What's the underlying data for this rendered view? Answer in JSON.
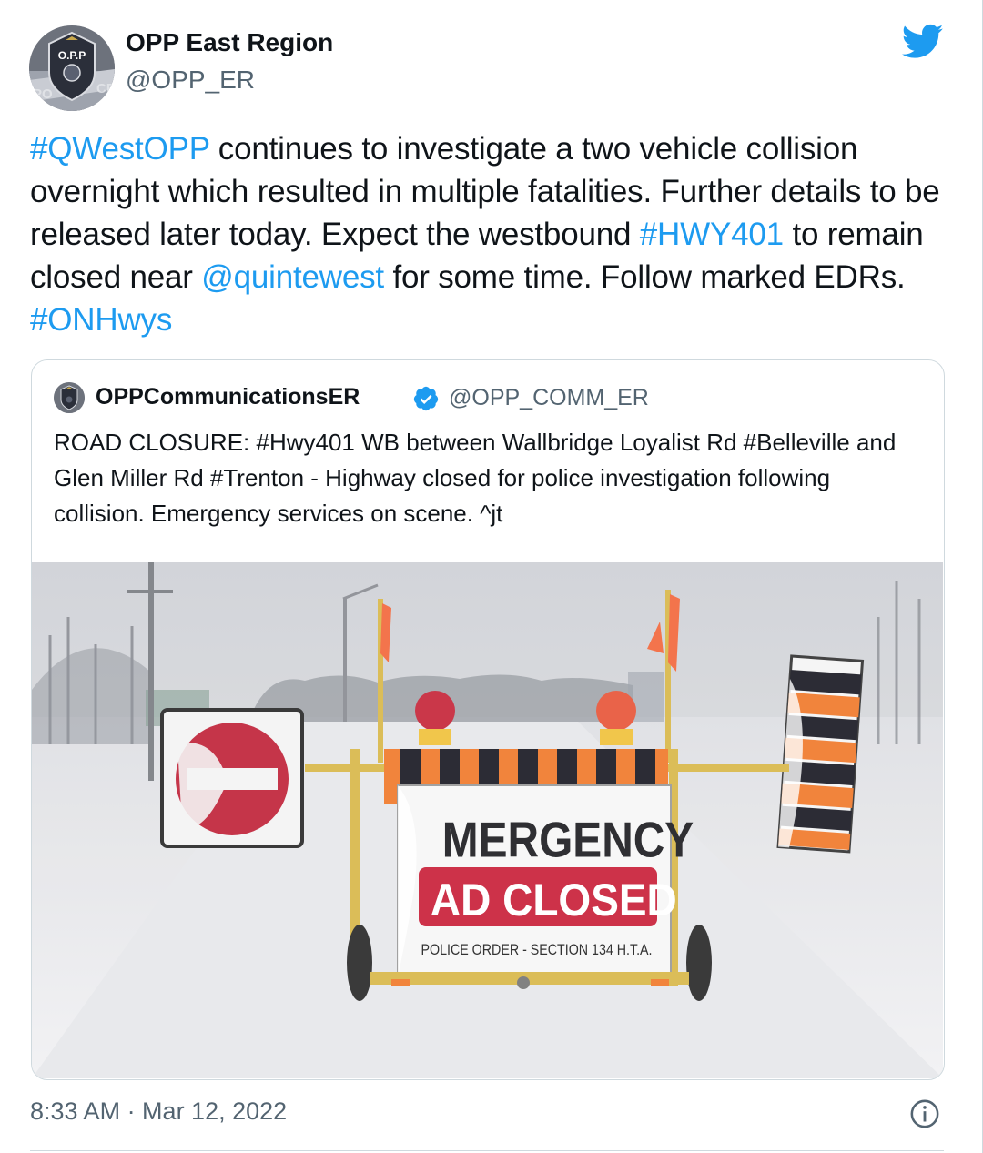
{
  "author": {
    "display_name": "OPP East Region",
    "handle": "@OPP_ER",
    "avatar_icon": "opp-badge-avatar"
  },
  "tweet": {
    "segments": [
      {
        "text": "#QWestOPP",
        "link": true
      },
      {
        "text": " continues to investigate a two vehicle collision overnight which resulted in multiple fatalities. Further details to be released later today. Expect the westbound ",
        "link": false
      },
      {
        "text": "#HWY401",
        "link": true
      },
      {
        "text": " to remain closed near ",
        "link": false
      },
      {
        "text": "@quintewest",
        "link": true
      },
      {
        "text": " for some time. Follow marked EDRs. ",
        "link": false
      },
      {
        "text": "#ONHwys",
        "link": true
      }
    ]
  },
  "quoted_tweet": {
    "display_name": "OPPCommunicationsER",
    "verified": true,
    "handle": "@OPP_COMM_ER",
    "text": "ROAD CLOSURE: #Hwy401 WB between Wallbridge Loyalist Rd #Belleville and Glen Miller Rd #Trenton - Highway closed for police investigation following collision. Emergency services on scene. ^jt",
    "image": {
      "sign_line1": "MERGENCY",
      "sign_line2": "AD CLOSED",
      "sign_line3": "POLICE ORDER - SECTION 134 H.T.A."
    }
  },
  "footer": {
    "timestamp": "8:33 AM · Mar 12, 2022",
    "info_icon": "info-icon"
  },
  "colors": {
    "link": "#1d9bf0",
    "text": "#0f1419",
    "secondary": "#536471",
    "border": "#cfd9de"
  }
}
